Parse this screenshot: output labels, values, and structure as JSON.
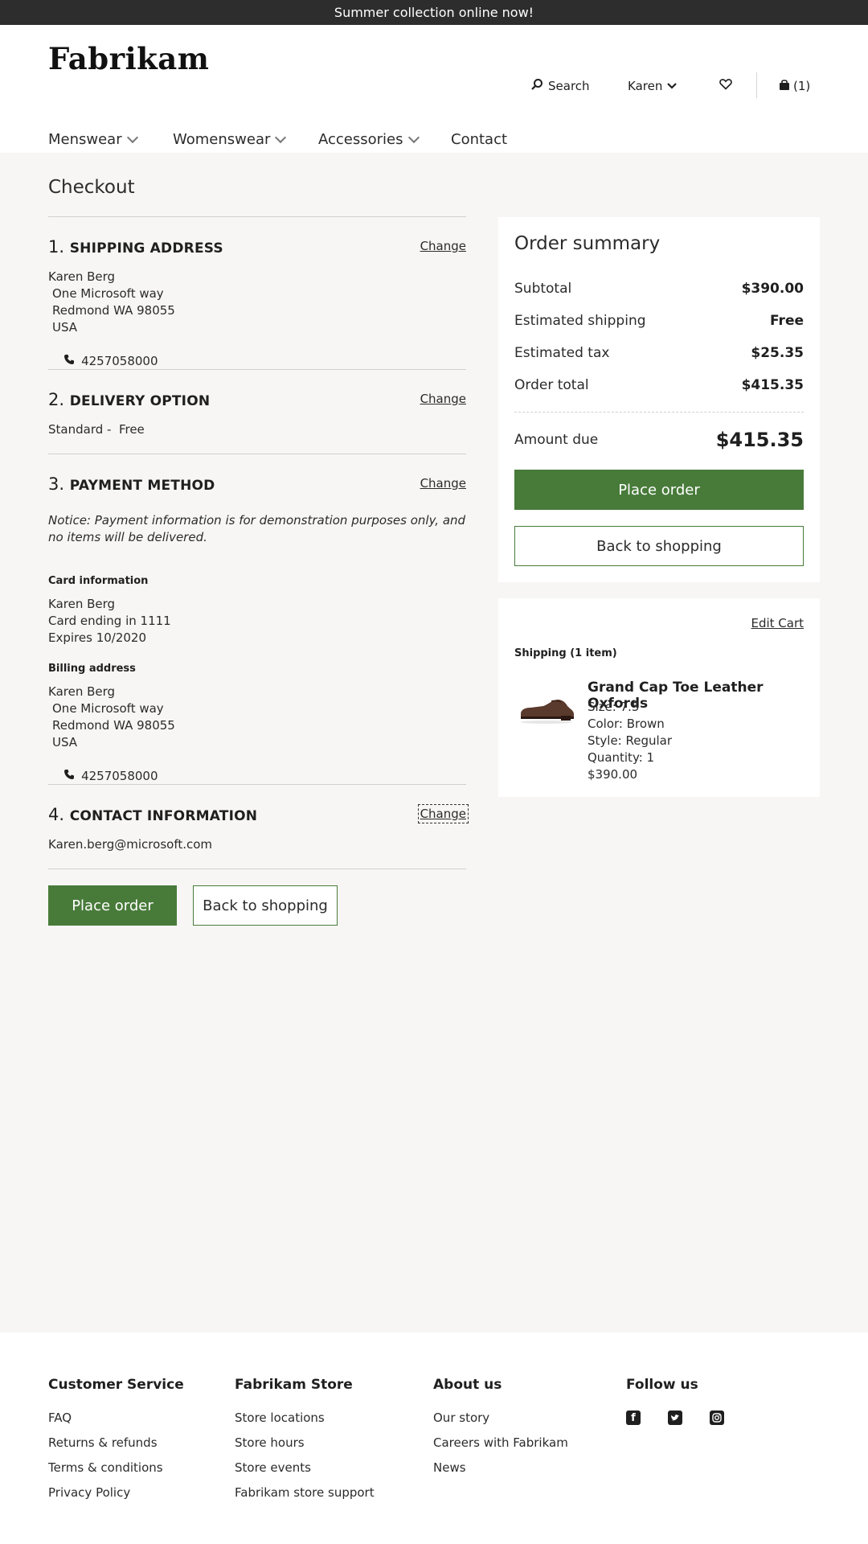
{
  "banner": {
    "text": "Summer collection online now!"
  },
  "header": {
    "logo": "Fabrikam",
    "search_label": "Search",
    "user_label": "Karen",
    "cart_label": "(1)"
  },
  "nav": {
    "items": [
      "Menswear",
      "Womenswear",
      "Accessories",
      "Contact"
    ]
  },
  "checkout": {
    "title": "Checkout",
    "change_label": "Change",
    "shipping": {
      "number": "1.",
      "title": "SHIPPING ADDRESS",
      "name": "Karen Berg",
      "street": "One Microsoft way",
      "city": "Redmond WA 98055",
      "country": "USA",
      "phone": "4257058000"
    },
    "delivery": {
      "number": "2.",
      "title": "DELIVERY OPTION",
      "option": "Standard -  Free"
    },
    "payment": {
      "number": "3.",
      "title": "PAYMENT METHOD",
      "notice": "Notice: Payment information is for demonstration purposes only, and no items will be delivered.",
      "card_heading": "Card information",
      "card_name": "Karen Berg",
      "card_ending": "Card ending in 1111",
      "card_expires": "Expires 10/2020",
      "billing_heading": "Billing address",
      "billing_name": "Karen Berg",
      "billing_street": "One Microsoft way",
      "billing_city": "Redmond WA 98055",
      "billing_country": "USA",
      "billing_phone": "4257058000"
    },
    "contact": {
      "number": "4.",
      "title": "CONTACT INFORMATION",
      "email": "Karen.berg@microsoft.com"
    },
    "place_order": "Place order",
    "back_to_shopping": "Back to shopping"
  },
  "summary": {
    "title": "Order summary",
    "subtotal_label": "Subtotal",
    "subtotal_value": "$390.00",
    "shipping_label": "Estimated shipping",
    "shipping_value": "Free",
    "tax_label": "Estimated tax",
    "tax_value": "$25.35",
    "total_label": "Order total",
    "total_value": "$415.35",
    "due_label": "Amount due",
    "due_value": "$415.35",
    "place_order": "Place order",
    "back_to_shopping": "Back to shopping"
  },
  "cart": {
    "edit_label": "Edit Cart",
    "shipping_heading": "Shipping (1 item)",
    "item": {
      "name": "Grand Cap Toe Leather Oxfords",
      "size": "Size: 7.5",
      "color": "Color: Brown",
      "style": "Style: Regular",
      "quantity": "Quantity: 1",
      "price": "$390.00"
    }
  },
  "footer": {
    "customer_service": {
      "title": "Customer Service",
      "links": [
        "FAQ",
        "Returns & refunds",
        "Terms & conditions",
        "Privacy Policy"
      ]
    },
    "store": {
      "title": "Fabrikam Store",
      "links": [
        "Store locations",
        "Store hours",
        "Store events",
        "Fabrikam store support"
      ]
    },
    "about": {
      "title": "About us",
      "links": [
        "Our story",
        "Careers with Fabrikam",
        "News"
      ]
    },
    "follow": {
      "title": "Follow us",
      "icons": [
        "facebook-icon",
        "twitter-icon",
        "instagram-icon"
      ]
    }
  },
  "colors": {
    "accent": "#487b3a",
    "banner": "#2d2d2d",
    "page_bg": "#f7f6f4"
  }
}
